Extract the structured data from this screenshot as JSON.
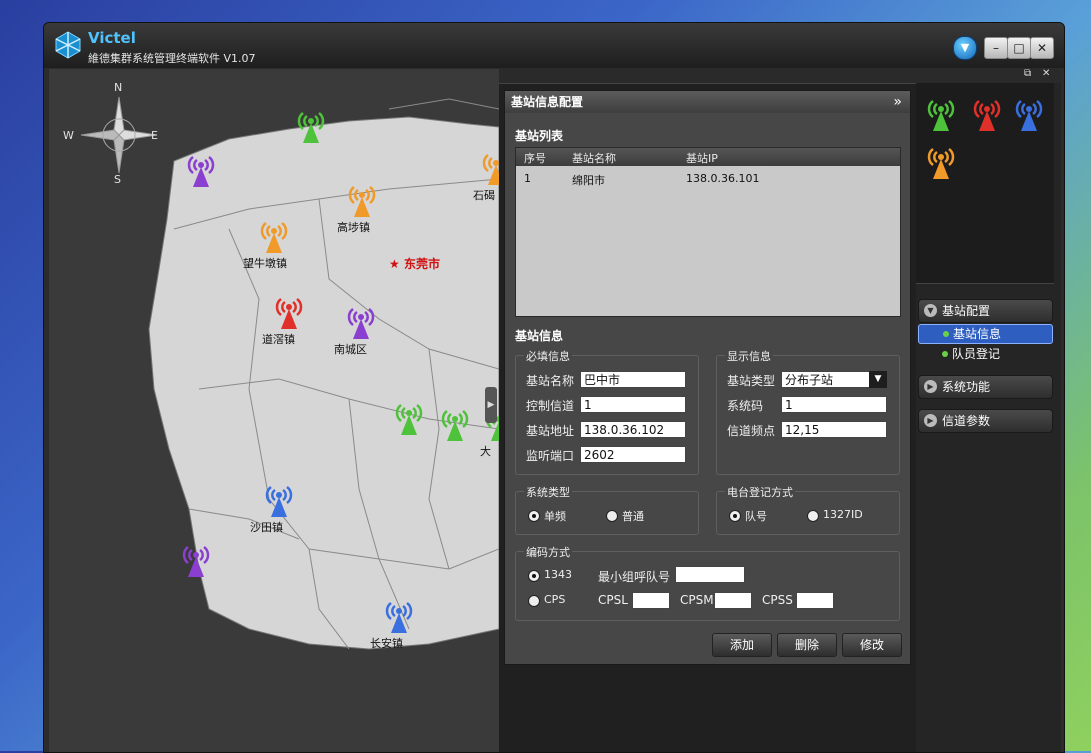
{
  "window": {
    "brand": "Victel",
    "subtitle": "維德集群系统管理终端软件 V1.07"
  },
  "colors": {
    "accent_blue": "#4fc3ff",
    "map_land": "#d6d6d6",
    "map_bg": "#3a3a3a",
    "selected_nav": "#2e5fc0",
    "city_marker": "#d01010"
  },
  "compass": {
    "n": "N",
    "s": "S",
    "e": "E",
    "w": "W"
  },
  "map": {
    "city": "东莞市",
    "stations": [
      {
        "label": "",
        "color": "green"
      },
      {
        "label": "",
        "color": "purple"
      },
      {
        "label": "石碣",
        "color": "orange"
      },
      {
        "label": "高埗镇",
        "color": "orange"
      },
      {
        "label": "望牛墩镇",
        "color": "orange"
      },
      {
        "label": "道滘镇",
        "color": "red"
      },
      {
        "label": "南城区",
        "color": "purple"
      },
      {
        "label": "",
        "color": "green"
      },
      {
        "label": "",
        "color": "green"
      },
      {
        "label": "大",
        "color": "green"
      },
      {
        "label": "沙田镇",
        "color": "blue"
      },
      {
        "label": "",
        "color": "purple"
      },
      {
        "label": "长安镇",
        "color": "blue"
      }
    ]
  },
  "panel": {
    "title": "基站信息配置",
    "collapse_icon": "double-chevron-right-icon",
    "list_section": "基站列表",
    "list_headers": [
      "序号",
      "基站名称",
      "基站IP"
    ],
    "list_rows": [
      {
        "no": "1",
        "name": "绵阳市",
        "ip": "138.0.36.101"
      }
    ],
    "info_section": "基站信息",
    "required_group": "必填信息",
    "display_group": "显示信息",
    "fields": {
      "name_label": "基站名称",
      "name_value": "巴中市",
      "channel_label": "控制信道",
      "channel_value": "1",
      "addr_label": "基站地址",
      "addr_value": "138.0.36.102",
      "port_label": "监听端口",
      "port_value": "2602",
      "type_label": "基站类型",
      "type_value": "分布子站",
      "syscode_label": "系统码",
      "syscode_value": "1",
      "freq_label": "信道频点",
      "freq_value": "12,15"
    },
    "sys_type": {
      "group": "系统类型",
      "opt1": "单频",
      "opt2": "普通",
      "selected": "单频"
    },
    "reg_mode": {
      "group": "电台登记方式",
      "opt1": "队号",
      "opt2": "1327ID",
      "selected": "队号"
    },
    "coding": {
      "group": "编码方式",
      "opt1": "1343",
      "opt2": "CPS",
      "selected": "1343",
      "min_group_label": "最小组呼队号",
      "min_group_value": "",
      "cpsl": "CPSL",
      "cpsm": "CPSM",
      "cpss": "CPSS"
    },
    "buttons": {
      "add": "添加",
      "delete": "删除",
      "modify": "修改"
    }
  },
  "sidebar": {
    "sections": [
      {
        "label": "基站配置",
        "expanded": true,
        "items": [
          {
            "label": "基站信息",
            "selected": true
          },
          {
            "label": "队员登记",
            "selected": false
          }
        ]
      },
      {
        "label": "系统功能",
        "expanded": false
      },
      {
        "label": "信道参数",
        "expanded": false
      }
    ]
  }
}
